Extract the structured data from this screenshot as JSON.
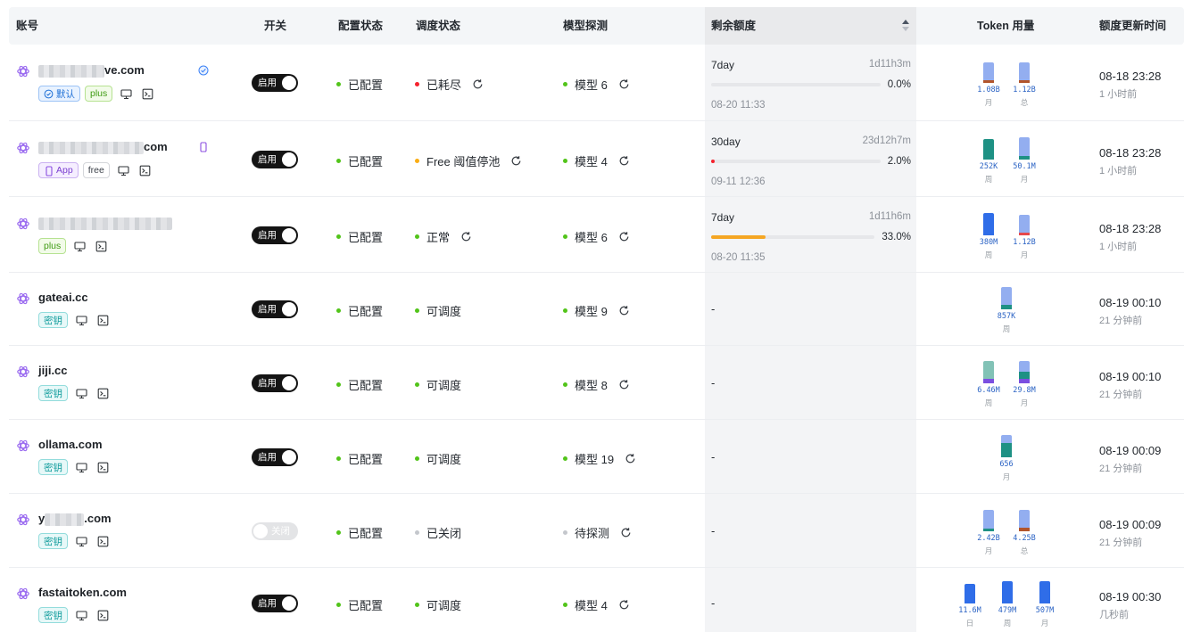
{
  "headers": {
    "account": "账号",
    "switch": "开关",
    "config": "配置状态",
    "schedule": "调度状态",
    "model": "模型探测",
    "quota": "剩余额度",
    "token": "Token 用量",
    "updated": "额度更新时间"
  },
  "colors": {
    "toggle_on": "#141414",
    "toggle_off": "#e3e4e6",
    "status_green": "#52c41a",
    "status_red": "#f5222d",
    "status_orange": "#faad14",
    "status_gray": "#c4c7cc",
    "usage_light_blue": "#93aef0",
    "usage_blue": "#2f6de8",
    "usage_teal": "#1e9184",
    "usage_brown": "#b2552b",
    "usage_purple": "#7b4fe0",
    "usage_sage": "#82c2b6",
    "quota_orange": "#f5a623",
    "quota_red": "#f5222d"
  },
  "rows": [
    {
      "name": "ve.com",
      "mark": "check-badge-icon",
      "tags": [
        {
          "type": "blue",
          "icon": "check-circle-icon",
          "label": "默认"
        },
        {
          "type": "green",
          "label": "plus"
        }
      ],
      "toggle": "启用",
      "toggle_on": true,
      "config": "已配置",
      "config_dot": "green",
      "schedule": "已耗尽",
      "schedule_dot": "red",
      "schedule_refresh": true,
      "model": "模型 6",
      "model_dot": "green",
      "quota": {
        "period": "7day",
        "remain": "1d11h3m",
        "pct": "0.0%",
        "fill": 0.0,
        "date": "08-20 11:33",
        "color": "#f5222d"
      },
      "usage": [
        {
          "value": "1.08B",
          "period": "月",
          "segs": [
            {
              "c": "#93aef0",
              "v": 0.78
            },
            {
              "c": "#b2552b",
              "v": 0.12
            }
          ]
        },
        {
          "value": "1.12B",
          "period": "总",
          "segs": [
            {
              "c": "#93aef0",
              "v": 0.78
            },
            {
              "c": "#b2552b",
              "v": 0.12
            }
          ]
        }
      ],
      "updated": "08-18 23:28",
      "relative": "1 小时前"
    },
    {
      "name": "com",
      "mark": "phone-icon",
      "tags": [
        {
          "type": "purple",
          "icon": "phone-icon",
          "label": "App"
        },
        {
          "type": "gray",
          "label": "free"
        }
      ],
      "toggle": "启用",
      "toggle_on": true,
      "config": "已配置",
      "config_dot": "green",
      "schedule": "Free 阈值停池",
      "schedule_dot": "orange",
      "schedule_refresh": true,
      "model": "模型 4",
      "model_dot": "green",
      "quota": {
        "period": "30day",
        "remain": "23d12h7m",
        "pct": "2.0%",
        "fill": 0.02,
        "date": "09-11 12:36",
        "color": "#f5222d"
      },
      "usage": [
        {
          "value": "252K",
          "period": "周",
          "segs": [
            {
              "c": "#1e9184",
              "v": 0.9
            }
          ]
        },
        {
          "value": "50.1M",
          "period": "月",
          "segs": [
            {
              "c": "#93aef0",
              "v": 0.8
            },
            {
              "c": "#1e9184",
              "v": 0.15
            }
          ]
        }
      ],
      "updated": "08-18 23:28",
      "relative": "1 小时前"
    },
    {
      "name": "",
      "mark": "",
      "tags": [
        {
          "type": "green",
          "label": "plus"
        }
      ],
      "toggle": "启用",
      "toggle_on": true,
      "config": "已配置",
      "config_dot": "green",
      "schedule": "正常",
      "schedule_dot": "green",
      "schedule_refresh": true,
      "model": "模型 6",
      "model_dot": "green",
      "quota": {
        "period": "7day",
        "remain": "1d11h6m",
        "pct": "33.0%",
        "fill": 0.33,
        "date": "08-20 11:35",
        "color": "#f5a623"
      },
      "usage": [
        {
          "value": "380M",
          "period": "周",
          "segs": [
            {
              "c": "#2f6de8",
              "v": 0.95
            }
          ]
        },
        {
          "value": "1.12B",
          "period": "月",
          "segs": [
            {
              "c": "#93aef0",
              "v": 0.78
            },
            {
              "c": "#e5484d",
              "v": 0.12
            }
          ]
        }
      ],
      "updated": "08-18 23:28",
      "relative": "1 小时前"
    },
    {
      "name": "gateai.cc",
      "mark": "",
      "tags": [
        {
          "type": "cyan",
          "label": "密钥"
        }
      ],
      "toggle": "启用",
      "toggle_on": true,
      "config": "已配置",
      "config_dot": "green",
      "schedule": "可调度",
      "schedule_dot": "green",
      "schedule_refresh": false,
      "model": "模型 9",
      "model_dot": "green",
      "quota": null,
      "quota_dash": "-",
      "usage": [
        {
          "value": "857K",
          "period": "周",
          "segs": [
            {
              "c": "#93aef0",
              "v": 0.78
            },
            {
              "c": "#1e9184",
              "v": 0.18
            }
          ]
        }
      ],
      "updated": "08-19 00:10",
      "relative": "21 分钟前"
    },
    {
      "name": "jiji.cc",
      "mark": "",
      "tags": [
        {
          "type": "cyan",
          "label": "密钥"
        }
      ],
      "toggle": "启用",
      "toggle_on": true,
      "config": "已配置",
      "config_dot": "green",
      "schedule": "可调度",
      "schedule_dot": "green",
      "schedule_refresh": false,
      "model": "模型 8",
      "model_dot": "green",
      "quota": null,
      "quota_dash": "-",
      "usage": [
        {
          "value": "6.46M",
          "period": "周",
          "segs": [
            {
              "c": "#82c2b6",
              "v": 0.75
            },
            {
              "c": "#7b4fe0",
              "v": 0.2
            }
          ]
        },
        {
          "value": "29.8M",
          "period": "月",
          "segs": [
            {
              "c": "#93aef0",
              "v": 0.45
            },
            {
              "c": "#1e9184",
              "v": 0.3
            },
            {
              "c": "#7b4fe0",
              "v": 0.2
            }
          ]
        }
      ],
      "updated": "08-19 00:10",
      "relative": "21 分钟前"
    },
    {
      "name": "ollama.com",
      "mark": "",
      "tags": [
        {
          "type": "cyan",
          "label": "密钥"
        }
      ],
      "toggle": "启用",
      "toggle_on": true,
      "config": "已配置",
      "config_dot": "green",
      "schedule": "可调度",
      "schedule_dot": "green",
      "schedule_refresh": false,
      "model": "模型 19",
      "model_dot": "green",
      "quota": null,
      "quota_dash": "-",
      "usage": [
        {
          "value": "656",
          "period": "月",
          "segs": [
            {
              "c": "#93aef0",
              "v": 0.35
            },
            {
              "c": "#1e9184",
              "v": 0.6
            }
          ]
        }
      ],
      "updated": "08-19 00:09",
      "relative": "21 分钟前"
    },
    {
      "name": "y",
      "name_tail": ".com",
      "mark": "",
      "tags": [
        {
          "type": "cyan",
          "label": "密钥"
        }
      ],
      "toggle": "关闭",
      "toggle_on": false,
      "config": "已配置",
      "config_dot": "green",
      "schedule": "已关闭",
      "schedule_dot": "gray",
      "schedule_refresh": false,
      "model": "待探测",
      "model_dot": "gray",
      "quota": null,
      "quota_dash": "-",
      "usage": [
        {
          "value": "2.42B",
          "period": "月",
          "segs": [
            {
              "c": "#93aef0",
              "v": 0.82
            },
            {
              "c": "#1e9184",
              "v": 0.12
            }
          ]
        },
        {
          "value": "4.25B",
          "period": "总",
          "segs": [
            {
              "c": "#93aef0",
              "v": 0.78
            },
            {
              "c": "#b2552b",
              "v": 0.14
            }
          ]
        }
      ],
      "updated": "08-19 00:09",
      "relative": "21 分钟前"
    },
    {
      "name": "fastaitoken.com",
      "mark": "",
      "tags": [
        {
          "type": "cyan",
          "label": "密钥"
        }
      ],
      "toggle": "启用",
      "toggle_on": true,
      "config": "已配置",
      "config_dot": "green",
      "schedule": "可调度",
      "schedule_dot": "green",
      "schedule_refresh": false,
      "model": "模型 4",
      "model_dot": "green",
      "quota": null,
      "quota_dash": "-",
      "usage": [
        {
          "value": "11.6M",
          "period": "日",
          "segs": [
            {
              "c": "#2f6de8",
              "v": 0.85
            }
          ]
        },
        {
          "value": "479M",
          "period": "周",
          "segs": [
            {
              "c": "#2f6de8",
              "v": 0.95
            }
          ]
        },
        {
          "value": "507M",
          "period": "月",
          "segs": [
            {
              "c": "#2f6de8",
              "v": 0.95
            }
          ]
        }
      ],
      "updated": "08-19 00:30",
      "relative": "几秒前"
    }
  ]
}
